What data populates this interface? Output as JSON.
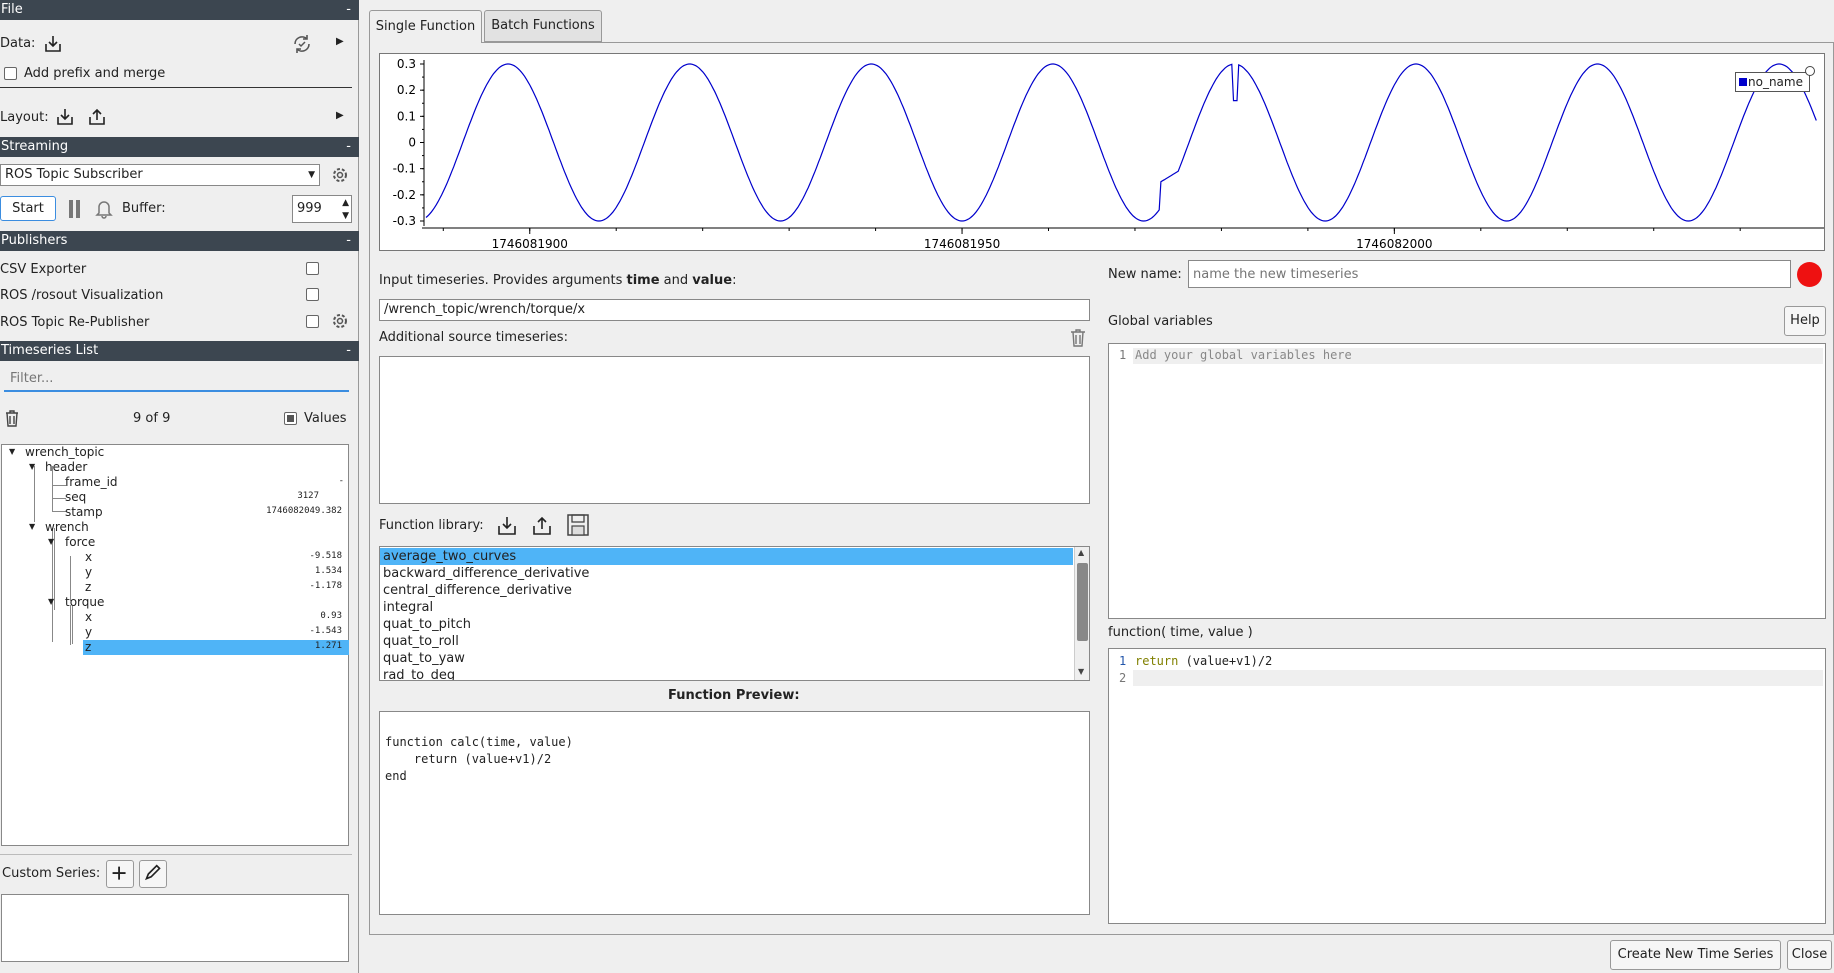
{
  "sidebar": {
    "file": {
      "title": "File",
      "collapse": "-",
      "data_label": "Data:",
      "add_prefix": "Add prefix and merge",
      "layout_label": "Layout:"
    },
    "streaming": {
      "title": "Streaming",
      "collapse": "-",
      "source": "ROS Topic Subscriber",
      "start": "Start",
      "buffer_label": "Buffer:",
      "buffer_value": "999"
    },
    "publishers": {
      "title": "Publishers",
      "collapse": "-",
      "items": [
        "CSV Exporter",
        "ROS /rosout Visualization",
        "ROS Topic Re-Publisher"
      ]
    },
    "timeseries": {
      "title": "Timeseries List",
      "collapse": "-",
      "filter_placeholder": "Filter...",
      "count": "9 of 9",
      "values_label": "Values"
    },
    "tree": {
      "root": "wrench_topic",
      "header": "header",
      "frame_id": "frame_id",
      "frame_id_val": "-",
      "seq": "seq",
      "seq_val": "3127",
      "stamp": "stamp",
      "stamp_val": "1746082049.382",
      "wrench": "wrench",
      "force": "force",
      "fx": "x",
      "fx_val": "-9.518",
      "fy": "y",
      "fy_val": "1.534",
      "fz": "z",
      "fz_val": "-1.178",
      "torque": "torque",
      "tx": "x",
      "tx_val": "0.93",
      "ty": "y",
      "ty_val": "-1.543",
      "tz": "z",
      "tz_val": "1.271"
    },
    "custom_series_label": "Custom Series:"
  },
  "tabs": [
    "Single Function",
    "Batch Functions"
  ],
  "chart_data": {
    "type": "line",
    "title": "",
    "series": [
      {
        "name": "no_name",
        "color": "#0000cc"
      }
    ],
    "y_ticks": [
      "0.3",
      "0.2",
      "0.1",
      "0",
      "-0.1",
      "-0.2",
      "-0.3"
    ],
    "ylim": [
      -0.3,
      0.3
    ],
    "x_ticks": [
      "1746081900",
      "1746081950",
      "1746082000"
    ],
    "xlim": [
      1746081888,
      1746082049
    ],
    "wave": {
      "amplitude": 0.3,
      "period_s": 21
    }
  },
  "editor": {
    "input_label_pre": "Input timeseries. Provides arguments ",
    "input_label_time": "time",
    "input_label_and": " and ",
    "input_label_value": "value",
    "input_label_post": ":",
    "input_value": "/wrench_topic/wrench/torque/x",
    "additional_label": "Additional source timeseries:",
    "library_label": "Function library:",
    "library_items": [
      "average_two_curves",
      "backward_difference_derivative",
      "central_difference_derivative",
      "integral",
      "quat_to_pitch",
      "quat_to_roll",
      "quat_to_yaw",
      "rad_to_deg"
    ],
    "preview_label": "Function Preview:",
    "preview_lines": [
      "function calc(time, value)",
      "    return (value+v1)/2",
      "end"
    ],
    "new_name_label": "New name:",
    "new_name_placeholder": "name the new timeseries",
    "global_label": "Global variables",
    "help": "Help",
    "global_line_no": "1",
    "global_placeholder": "Add your global variables here",
    "function_label": "function( time, value )",
    "code_ln1": "1",
    "code_ln2": "2",
    "code_kw": "return",
    "code_rest": " (value+v1)/2",
    "create_button": "Create New Time Series",
    "close_button": "Close"
  }
}
